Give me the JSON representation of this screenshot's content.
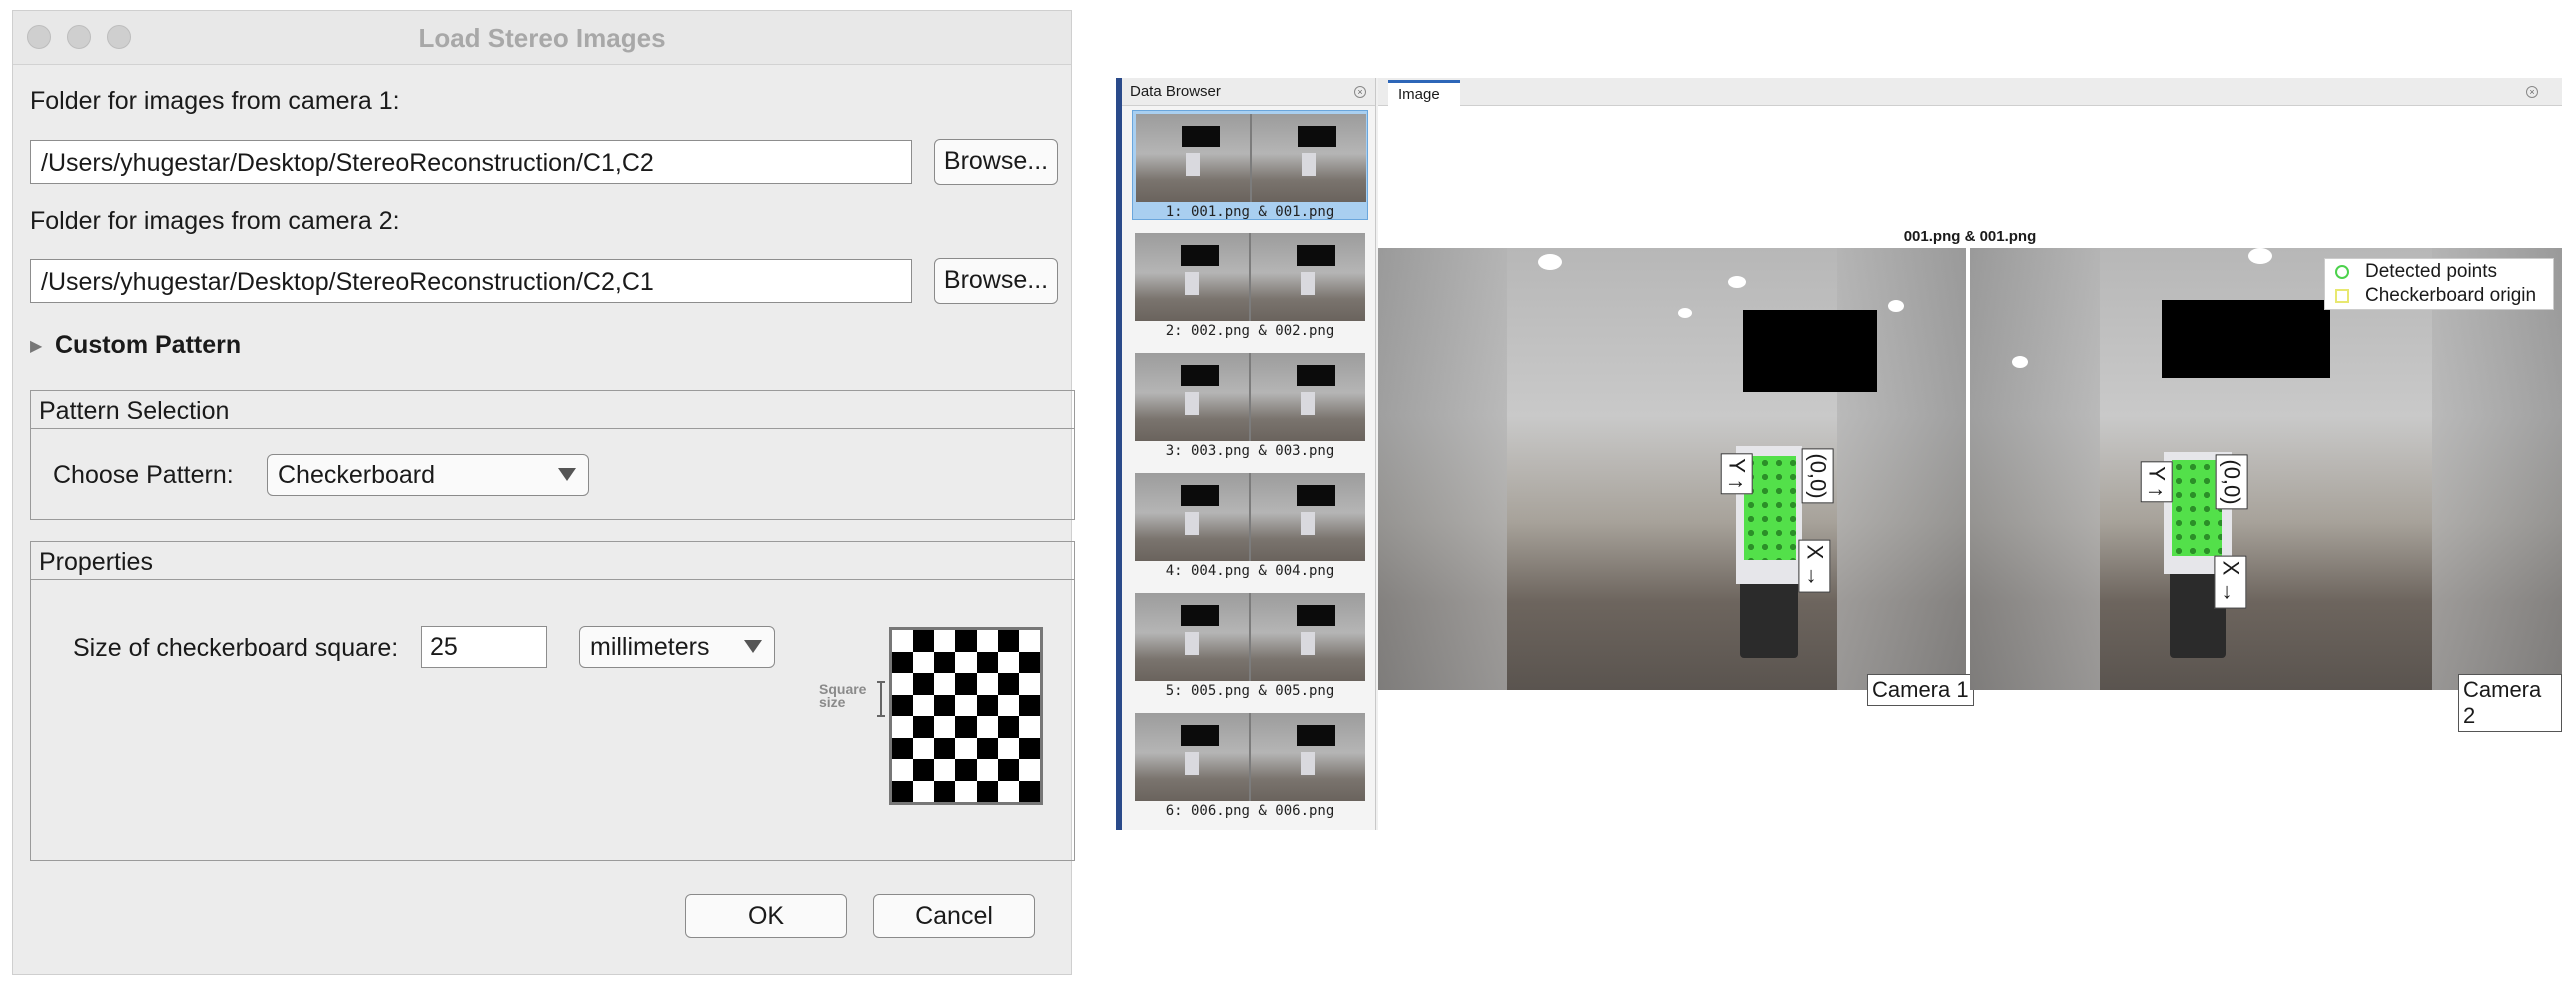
{
  "dialog": {
    "title": "Load Stereo Images",
    "camera1_label": "Folder for images from camera 1:",
    "camera1_path": "/Users/yhugestar/Desktop/StereoReconstruction/C1,C2",
    "camera2_label": "Folder for images from camera 2:",
    "camera2_path": "/Users/yhugestar/Desktop/StereoReconstruction/C2,C1",
    "browse_label": "Browse...",
    "custom_pattern_label": "Custom Pattern",
    "pattern_selection_title": "Pattern Selection",
    "choose_pattern_label": "Choose Pattern:",
    "pattern_value": "Checkerboard",
    "properties_title": "Properties",
    "square_size_label": "Size of checkerboard square:",
    "square_size_value": "25",
    "units_value": "millimeters",
    "preview_caption": "Square size",
    "ok_label": "OK",
    "cancel_label": "Cancel"
  },
  "data_browser": {
    "title": "Data Browser",
    "items": [
      {
        "label": "1: 001.png & 001.png",
        "selected": true
      },
      {
        "label": "2: 002.png & 002.png",
        "selected": false
      },
      {
        "label": "3: 003.png & 003.png",
        "selected": false
      },
      {
        "label": "4: 004.png & 004.png",
        "selected": false
      },
      {
        "label": "5: 005.png & 005.png",
        "selected": false
      },
      {
        "label": "6: 006.png & 006.png",
        "selected": false
      }
    ]
  },
  "image_panel": {
    "tab_label": "Image",
    "image_title": "001.png & 001.png",
    "camera1_label": "Camera 1",
    "camera2_label": "Camera 2",
    "origin_tag": "(0,0)",
    "y_tag": "Y ↑",
    "x_tag": "X →",
    "legend": {
      "detected_points": "Detected points",
      "checkerboard_origin": "Checkerboard origin"
    }
  },
  "colors": {
    "detected_points": "#4cd24c",
    "checkerboard_origin": "#e8e870",
    "tab_accent": "#2d66b8",
    "selection": "#a9cff0"
  }
}
